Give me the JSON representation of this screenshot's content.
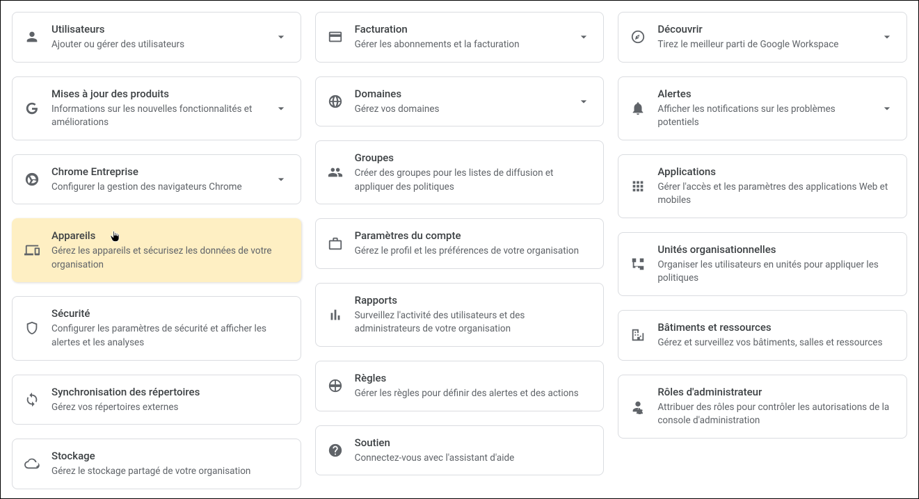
{
  "col1": [
    {
      "title": "Utilisateurs",
      "desc": "Ajouter ou gérer des utilisateurs"
    },
    {
      "title": "Mises à jour des produits",
      "desc": "Informations sur les nouvelles fonctionnalités et améliorations"
    },
    {
      "title": "Chrome Entreprise",
      "desc": "Configurer la gestion des navigateurs Chrome"
    },
    {
      "title": "Appareils",
      "desc": "Gérez les appareils et sécurisez les données de votre organisation"
    },
    {
      "title": "Sécurité",
      "desc": "Configurer les paramètres de sécurité et afficher les alertes et les analyses"
    },
    {
      "title": "Synchronisation des répertoires",
      "desc": "Gérez vos répertoires externes"
    },
    {
      "title": "Stockage",
      "desc": "Gérez le stockage partagé de votre organisation"
    }
  ],
  "col2": [
    {
      "title": "Facturation",
      "desc": "Gérer les abonnements et la facturation"
    },
    {
      "title": "Domaines",
      "desc": "Gérez vos domaines"
    },
    {
      "title": "Groupes",
      "desc": "Créer des groupes pour les listes de diffusion et appliquer des politiques"
    },
    {
      "title": "Paramètres du compte",
      "desc": "Gérez le profil et les préférences de votre organisation"
    },
    {
      "title": "Rapports",
      "desc": "Surveillez l'activité des utilisateurs et des administrateurs de votre organisation"
    },
    {
      "title": "Règles",
      "desc": "Gérer les règles pour définir des alertes et des actions"
    },
    {
      "title": "Soutien",
      "desc": "Connectez-vous avec l'assistant d'aide"
    }
  ],
  "col3": [
    {
      "title": "Découvrir",
      "desc": "Tirez le meilleur parti de Google Workspace"
    },
    {
      "title": "Alertes",
      "desc": "Afficher les notifications sur les problèmes potentiels"
    },
    {
      "title": "Applications",
      "desc": "Gérer l'accès et les paramètres des applications Web et mobiles"
    },
    {
      "title": "Unités organisationnelles",
      "desc": "Organiser les utilisateurs en unités pour appliquer les politiques"
    },
    {
      "title": "Bâtiments et ressources",
      "desc": "Gérez et surveillez vos bâtiments, salles et ressources"
    },
    {
      "title": "Rôles d'administrateur",
      "desc": "Attribuer des rôles pour contrôler les autorisations de la console d'administration"
    }
  ]
}
